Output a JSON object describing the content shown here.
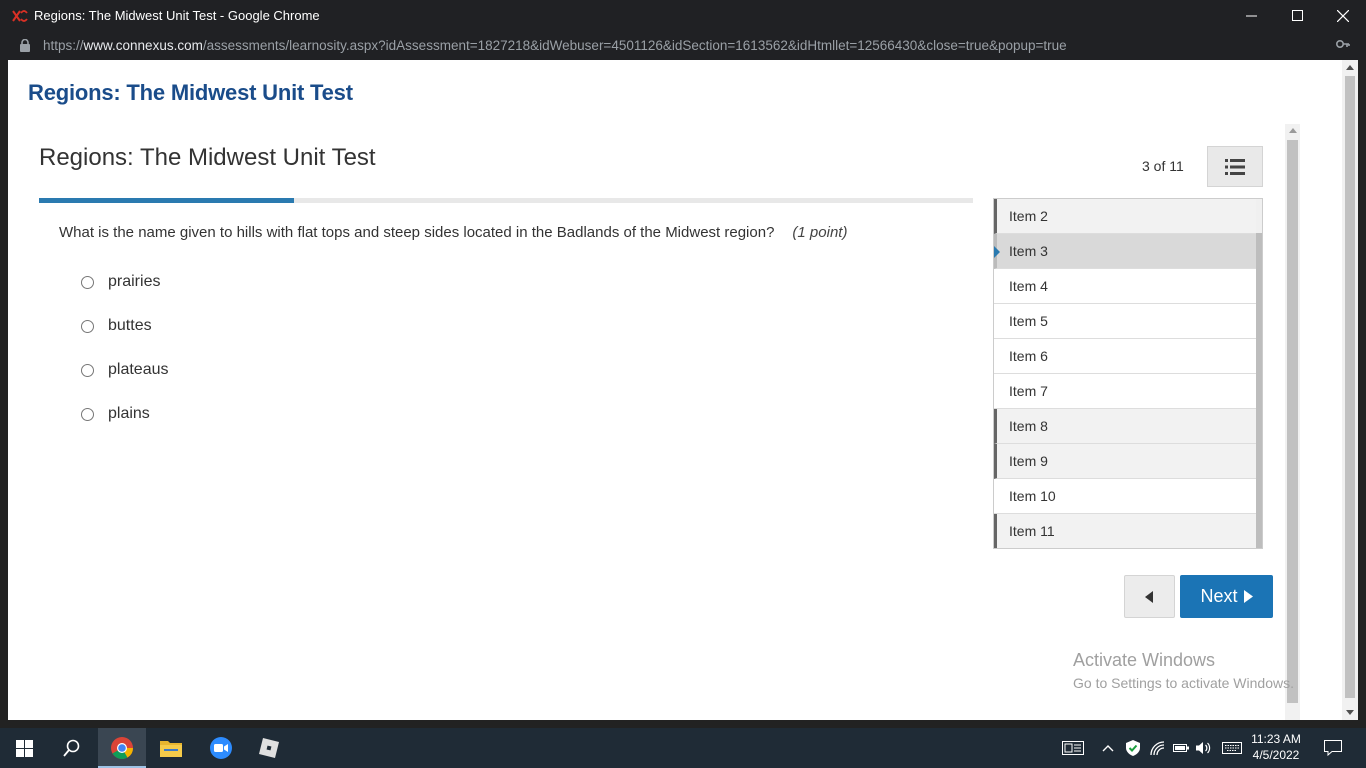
{
  "window": {
    "title": "Regions: The Midwest Unit Test - Google Chrome"
  },
  "address_bar": {
    "scheme": "https://",
    "host": "www.connexus.com",
    "path": "/assessments/learnosity.aspx?idAssessment=1827218&idWebuser=4501126&idSection=1613562&idHtmllet=12566430&close=true&popup=true"
  },
  "page": {
    "title": "Regions: The Midwest Unit Test"
  },
  "assessment": {
    "title": "Regions: The Midwest Unit Test",
    "progress_fraction": 0.273,
    "counter": "3 of 11",
    "question": "What is the name given to hills with flat tops and steep sides located in the Badlands of the Midwest region?",
    "points": "(1 point)",
    "options": [
      "prairies",
      "buttes",
      "plateaus",
      "plains"
    ],
    "items": [
      {
        "label": "Item 2",
        "state": "answered"
      },
      {
        "label": "Item 3",
        "state": "current"
      },
      {
        "label": "Item 4",
        "state": "unanswered"
      },
      {
        "label": "Item 5",
        "state": "unanswered"
      },
      {
        "label": "Item 6",
        "state": "unanswered"
      },
      {
        "label": "Item 7",
        "state": "unanswered"
      },
      {
        "label": "Item 8",
        "state": "answered"
      },
      {
        "label": "Item 9",
        "state": "answered"
      },
      {
        "label": "Item 10",
        "state": "unanswered"
      },
      {
        "label": "Item 11",
        "state": "answered"
      }
    ],
    "next_label": "Next"
  },
  "watermark": {
    "line1": "Activate Windows",
    "line2": "Go to Settings to activate Windows."
  },
  "taskbar": {
    "time": "11:23 AM",
    "date": "4/5/2022"
  },
  "colors": {
    "title_blue": "#1a4c8a",
    "accent_blue": "#1b74b5",
    "progress_blue": "#2a7ab0"
  }
}
